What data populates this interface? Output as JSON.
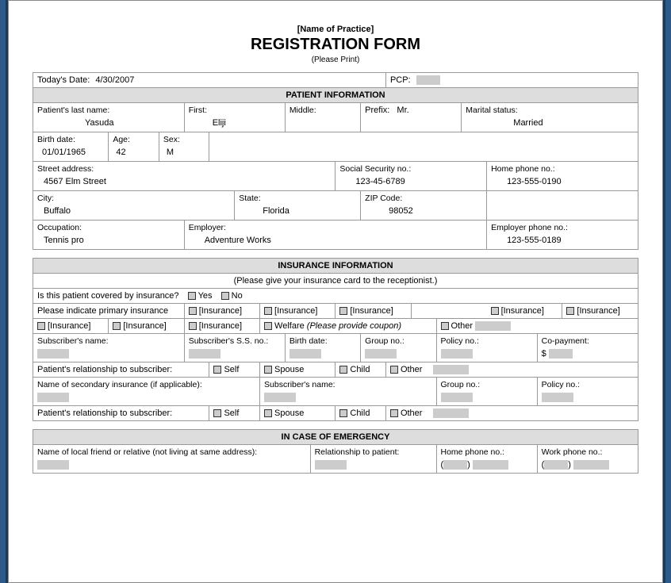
{
  "header": {
    "practice_name": "[Name of Practice]",
    "title": "REGISTRATION FORM",
    "please_print": "(Please Print)"
  },
  "top_row": {
    "date_label": "Today's Date:",
    "date_value": "4/30/2007",
    "pcp_label": "PCP:"
  },
  "patient_section": {
    "header": "PATIENT INFORMATION",
    "last_label": "Patient's last name:",
    "last_value": "Yasuda",
    "first_label": "First:",
    "first_value": "Eliji",
    "middle_label": "Middle:",
    "prefix_label": "Prefix:",
    "prefix_value": "Mr.",
    "marital_label": "Marital status:",
    "marital_value": "Married",
    "birth_label": "Birth date:",
    "birth_value": "01/01/1965",
    "age_label": "Age:",
    "age_value": "42",
    "sex_label": "Sex:",
    "sex_value": "M",
    "street_label": "Street address:",
    "street_value": "4567 Elm Street",
    "ssn_label": "Social Security no.:",
    "ssn_value": "123-45-6789",
    "homephone_label": "Home phone no.:",
    "homephone_value": "123-555-0190",
    "city_label": "City:",
    "city_value": "Buffalo",
    "state_label": "State:",
    "state_value": "Florida",
    "zip_label": "ZIP Code:",
    "zip_value": "98052",
    "occupation_label": "Occupation:",
    "occupation_value": "Tennis pro",
    "employer_label": "Employer:",
    "employer_value": "Adventure Works",
    "empphone_label": "Employer phone no.:",
    "empphone_value": "123-555-0189"
  },
  "insurance_section": {
    "header": "INSURANCE INFORMATION",
    "instruction": "(Please give your insurance card to the receptionist.)",
    "covered_q": "Is this patient covered by insurance?",
    "yes": "Yes",
    "no": "No",
    "primary_q": "Please indicate primary insurance",
    "ins_opt": "[Insurance]",
    "welfare": "Welfare",
    "welfare_note": "(Please provide coupon)",
    "other": "Other",
    "sub_name": "Subscriber's name:",
    "sub_ssn": "Subscriber's S.S. no.:",
    "birth": "Birth date:",
    "group": "Group no.:",
    "policy": "Policy no.:",
    "copay": "Co-payment:",
    "copay_prefix": "$",
    "rel_q": "Patient's relationship to subscriber:",
    "self": "Self",
    "spouse": "Spouse",
    "child": "Child",
    "secondary": "Name of secondary insurance (if applicable):"
  },
  "emergency_section": {
    "header": "IN CASE OF EMERGENCY",
    "friend": "Name of local friend or relative (not living at same address):",
    "rel": "Relationship to patient:",
    "home": "Home phone no.:",
    "work": "Work phone no.:",
    "paren_l": "(",
    "paren_r": ")"
  }
}
